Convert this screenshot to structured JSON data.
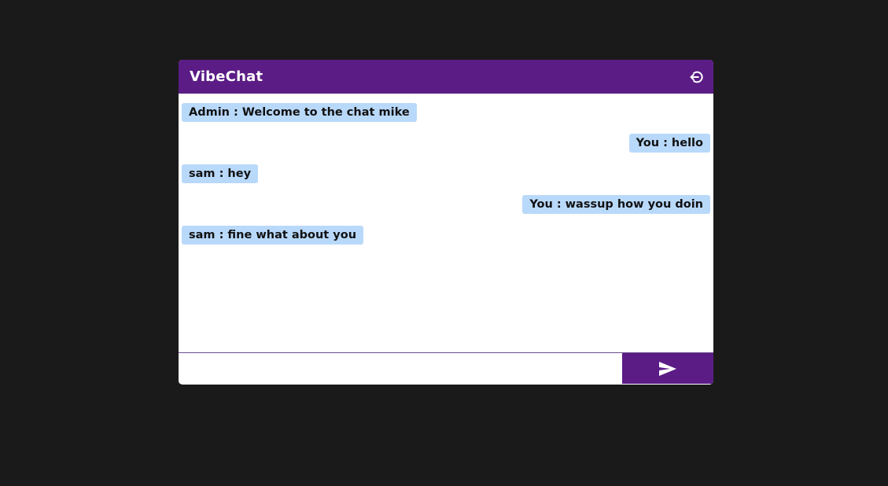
{
  "header": {
    "title": "VibeChat",
    "logout_icon": "logout-icon"
  },
  "messages": [
    {
      "sender": "Admin",
      "text": "Admin : Welcome to the chat mike",
      "own": false
    },
    {
      "sender": "You",
      "text": "You : hello",
      "own": true
    },
    {
      "sender": "sam",
      "text": "sam : hey",
      "own": false
    },
    {
      "sender": "You",
      "text": "You : wassup how you doin",
      "own": true
    },
    {
      "sender": "sam",
      "text": "sam : fine what about you",
      "own": false
    }
  ],
  "composer": {
    "input_value": "",
    "placeholder": "",
    "send_icon": "send-icon"
  },
  "colors": {
    "accent": "#5b1c85",
    "bubble": "#b9d9fb",
    "background": "#1a1a1a"
  }
}
